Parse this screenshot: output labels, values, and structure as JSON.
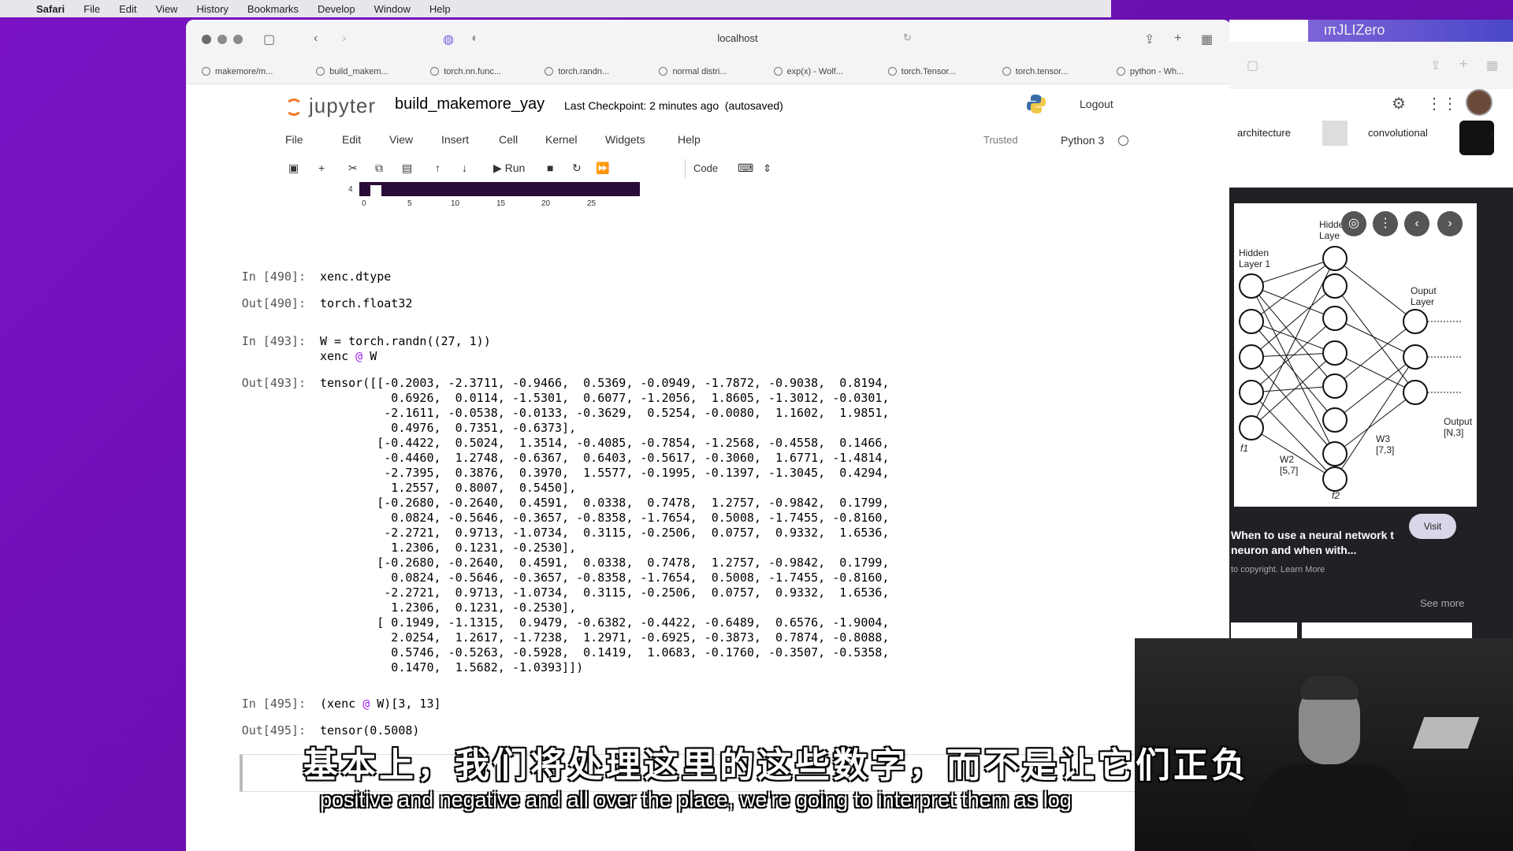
{
  "menubar": {
    "app": "Safari",
    "items": [
      "File",
      "Edit",
      "View",
      "History",
      "Bookmarks",
      "Develop",
      "Window",
      "Help"
    ]
  },
  "browser": {
    "address": "localhost",
    "tabs": [
      {
        "label": "makemore/m...",
        "icon": "github-icon"
      },
      {
        "label": "build_makem...",
        "icon": "notebook-icon"
      },
      {
        "label": "torch.nn.func...",
        "icon": "torch-icon"
      },
      {
        "label": "torch.randn...",
        "icon": "torch-icon"
      },
      {
        "label": "normal distri...",
        "icon": "google-icon"
      },
      {
        "label": "exp(x) - Wolf...",
        "icon": "wolfram-icon"
      },
      {
        "label": "torch.Tensor...",
        "icon": "torch-icon"
      },
      {
        "label": "torch.tensor...",
        "icon": "torch-icon"
      },
      {
        "label": "python - Wh...",
        "icon": "torch-icon"
      }
    ]
  },
  "jupyter": {
    "logo_text": "jupyter",
    "notebook_name": "build_makemore_yay",
    "checkpoint": "Last Checkpoint: 2 minutes ago  (autosaved)",
    "logout": "Logout",
    "menu": [
      "File",
      "Edit",
      "View",
      "Insert",
      "Cell",
      "Kernel",
      "Widgets",
      "Help"
    ],
    "trusted": "Trusted",
    "kernel": "Python 3",
    "toolbar": {
      "run": "Run",
      "cell_type": "Code"
    },
    "plot": {
      "y_tick": "4",
      "x_ticks": [
        "0",
        "5",
        "10",
        "15",
        "20",
        "25"
      ]
    }
  },
  "cells": [
    {
      "prompt": "In [490]:",
      "code": "xenc.dtype"
    },
    {
      "prompt": "Out[490]:",
      "code": "torch.float32"
    },
    {
      "prompt": "In [493]:",
      "code": "W = torch.randn((27, 1))\nxenc @ W"
    },
    {
      "prompt": "Out[493]:",
      "code": "tensor([[-0.2003, -2.3711, -0.9466,  0.5369, -0.0949, -1.7872, -0.9038,  0.8194,\n          0.6926,  0.0114, -1.5301,  0.6077, -1.2056,  1.8605, -1.3012, -0.0301,\n         -2.1611, -0.0538, -0.0133, -0.3629,  0.5254, -0.0080,  1.1602,  1.9851,\n          0.4976,  0.7351, -0.6373],\n        [-0.4422,  0.5024,  1.3514, -0.4085, -0.7854, -1.2568, -0.4558,  0.1466,\n         -0.4460,  1.2748, -0.6367,  0.6403, -0.5617, -0.3060,  1.6771, -1.4814,\n         -2.7395,  0.3876,  0.3970,  1.5577, -0.1995, -0.1397, -1.3045,  0.4294,\n          1.2557,  0.8007,  0.5450],\n        [-0.2680, -0.2640,  0.4591,  0.0338,  0.7478,  1.2757, -0.9842,  0.1799,\n          0.0824, -0.5646, -0.3657, -0.8358, -1.7654,  0.5008, -1.7455, -0.8160,\n         -2.2721,  0.9713, -1.0734,  0.3115, -0.2506,  0.0757,  0.9332,  1.6536,\n          1.2306,  0.1231, -0.2530],\n        [-0.2680, -0.2640,  0.4591,  0.0338,  0.7478,  1.2757, -0.9842,  0.1799,\n          0.0824, -0.5646, -0.3657, -0.8358, -1.7654,  0.5008, -1.7455, -0.8160,\n         -2.2721,  0.9713, -1.0734,  0.3115, -0.2506,  0.0757,  0.9332,  1.6536,\n          1.2306,  0.1231, -0.2530],\n        [ 0.1949, -1.1315,  0.9479, -0.6382, -0.4422, -0.6489,  0.6576, -1.9004,\n          2.0254,  1.2617, -1.7238,  1.2971, -0.6925, -0.3873,  0.7874, -0.8088,\n          0.5746, -0.5263, -0.5928,  0.1419,  1.0683, -0.1760, -0.3507, -0.5358,\n          0.1470,  1.5682, -1.0393]])"
    },
    {
      "prompt": "In [495]:",
      "code": "(xenc @ W)[3, 13]"
    },
    {
      "prompt": "Out[495]:",
      "code": "tensor(0.5008)"
    }
  ],
  "right_panel": {
    "banner": "ιπJLIZero",
    "chips": [
      "architecture",
      "convolutional"
    ],
    "diagram_labels": {
      "hidden1": "Hidden Layer 1",
      "hidden2": "Hidden Laye",
      "output": "Ouput Layer",
      "output_shape": "Output [N,3]",
      "w2": "W2 [5,7]",
      "w3": "W3 [7,3]",
      "f1": "f1",
      "f2": "f2"
    },
    "result_title": "When to use a neural network t neuron and when with...",
    "copyright": "to copyright. Learn More",
    "visit": "Visit",
    "see_more": "See more"
  },
  "subtitles": {
    "chinese": "基本上，我们将处理这里的这些数字，而不是让它们正负",
    "english": "positive and negative and all over the place, we're going to interpret them as log"
  },
  "colors": {
    "desktop": "#7a12c4",
    "keyword": "#a020f0",
    "jupyter_orange": "#f37726"
  }
}
